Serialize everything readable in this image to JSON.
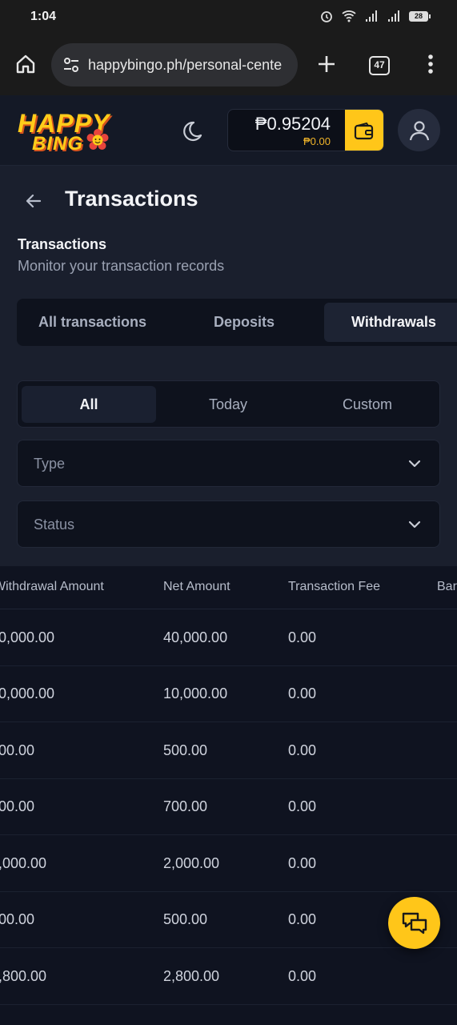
{
  "status_bar": {
    "time": "1:04",
    "battery": "28"
  },
  "browser": {
    "url": "happybingo.ph/personal-cente",
    "tab_count": "47"
  },
  "header": {
    "logo_top": "HAPPY",
    "logo_bottom": "BING",
    "balance": "₱0.95204",
    "bonus": "₱0.00"
  },
  "page": {
    "title": "Transactions",
    "section_title": "Transactions",
    "section_subtitle": "Monitor your transaction records"
  },
  "tabs": [
    {
      "label": "All transactions"
    },
    {
      "label": "Deposits"
    },
    {
      "label": "Withdrawals",
      "active": true
    }
  ],
  "date_filter": [
    {
      "label": "All",
      "active": true
    },
    {
      "label": "Today"
    },
    {
      "label": "Custom"
    }
  ],
  "filters": {
    "type_placeholder": "Type",
    "status_placeholder": "Status"
  },
  "table": {
    "columns": [
      "Withdrawal Amount",
      "Net Amount",
      "Transaction Fee",
      "Bar"
    ],
    "rows": [
      {
        "withdrawal": "0,000.00",
        "net": "40,000.00",
        "fee": "0.00"
      },
      {
        "withdrawal": "0,000.00",
        "net": "10,000.00",
        "fee": "0.00"
      },
      {
        "withdrawal": "00.00",
        "net": "500.00",
        "fee": "0.00"
      },
      {
        "withdrawal": "00.00",
        "net": "700.00",
        "fee": "0.00"
      },
      {
        "withdrawal": ",000.00",
        "net": "2,000.00",
        "fee": "0.00"
      },
      {
        "withdrawal": "00.00",
        "net": "500.00",
        "fee": "0.00"
      },
      {
        "withdrawal": ",800.00",
        "net": "2,800.00",
        "fee": "0.00"
      }
    ]
  },
  "icons": {
    "home": "home-icon",
    "site_settings": "tune-icon",
    "new_tab": "plus-icon",
    "menu": "more-vert-icon",
    "theme": "moon-icon",
    "wallet": "wallet-icon",
    "profile": "user-icon",
    "back": "arrow-left-icon",
    "dropdown": "chevron-down-icon",
    "chat": "chat-icon"
  },
  "colors": {
    "accent": "#ffc619",
    "bonus": "#f0b429",
    "background": "#0f1320",
    "panel": "#1a1f2d"
  }
}
